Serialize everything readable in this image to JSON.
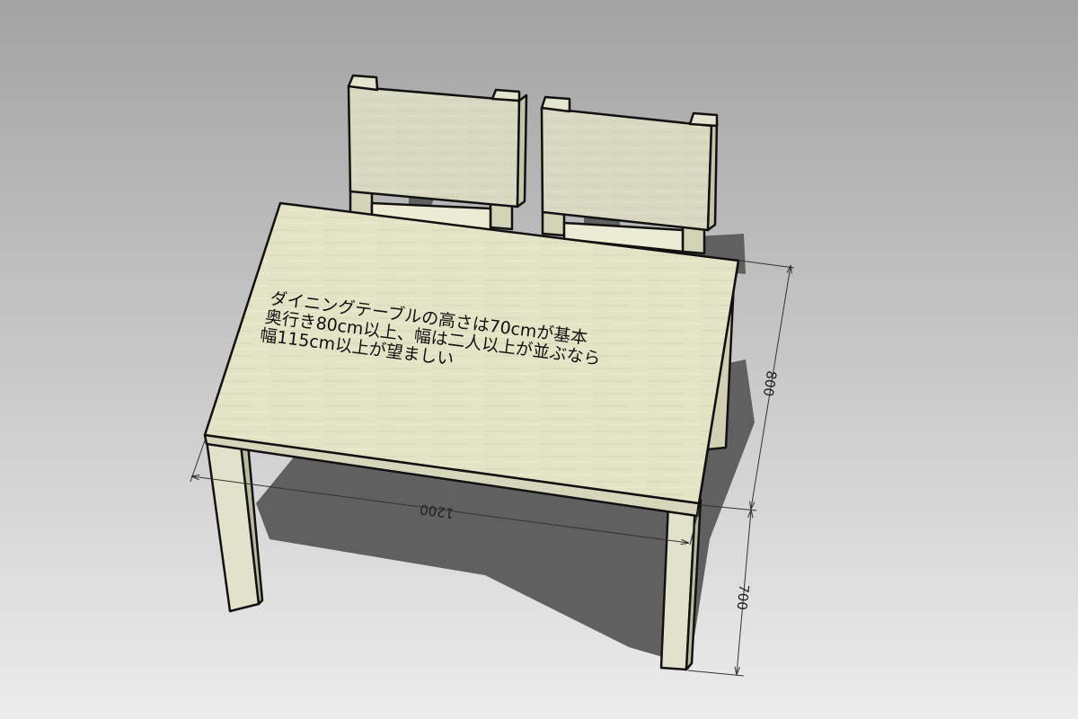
{
  "note": {
    "lines": [
      "ダイニングテーブルの高さは70cmが基本",
      "奥行き80cm以上、幅は二人以上が並ぶなら",
      "幅115cm以上が望ましい"
    ]
  },
  "dimensions": {
    "width": "1200",
    "depth": "800",
    "height": "700"
  },
  "colors": {
    "background_top": "#a3a3a3",
    "background_bottom": "#ececec",
    "wood": "#e3e3c6",
    "wood_side": "#c9c9ad",
    "shadow": "#5f5f5f",
    "outline": "#111111"
  }
}
